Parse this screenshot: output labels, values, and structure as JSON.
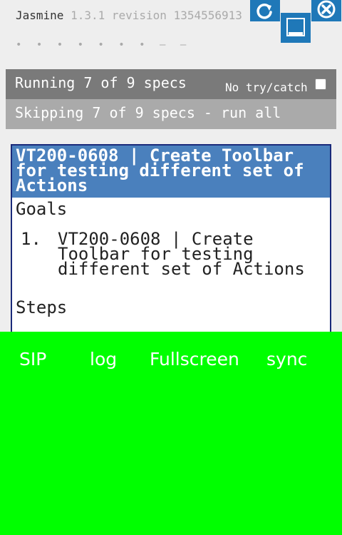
{
  "banner": {
    "title": "Jasmine",
    "version": "1.3.1 revision 1354556913",
    "dots": "• • • • • • • – –"
  },
  "toolbar": {
    "refresh_icon": "refresh-icon",
    "window_icon": "window-icon",
    "close_icon": "close-icon",
    "accent_color": "#1f78b8"
  },
  "status": {
    "running_label": "Running 7 of 9 specs",
    "trycatch_label": "No try/catch",
    "trycatch_checked": false,
    "skipping_label": "Skipping 7 of 9 specs - run all"
  },
  "spec": {
    "title": "VT200-0608 | Create Toolbar for testing different set of Actions",
    "goals_heading": "Goals",
    "goals": [
      {
        "number": "1.",
        "text": "VT200-0608 | Create Toolbar for testing different set of Actions"
      }
    ],
    "steps_heading": "Steps",
    "header_color": "#4a80bd"
  },
  "overlay": {
    "background_color": "#00ff00",
    "buttons": [
      "SIP",
      "log",
      "Fullscreen",
      "sync"
    ]
  }
}
